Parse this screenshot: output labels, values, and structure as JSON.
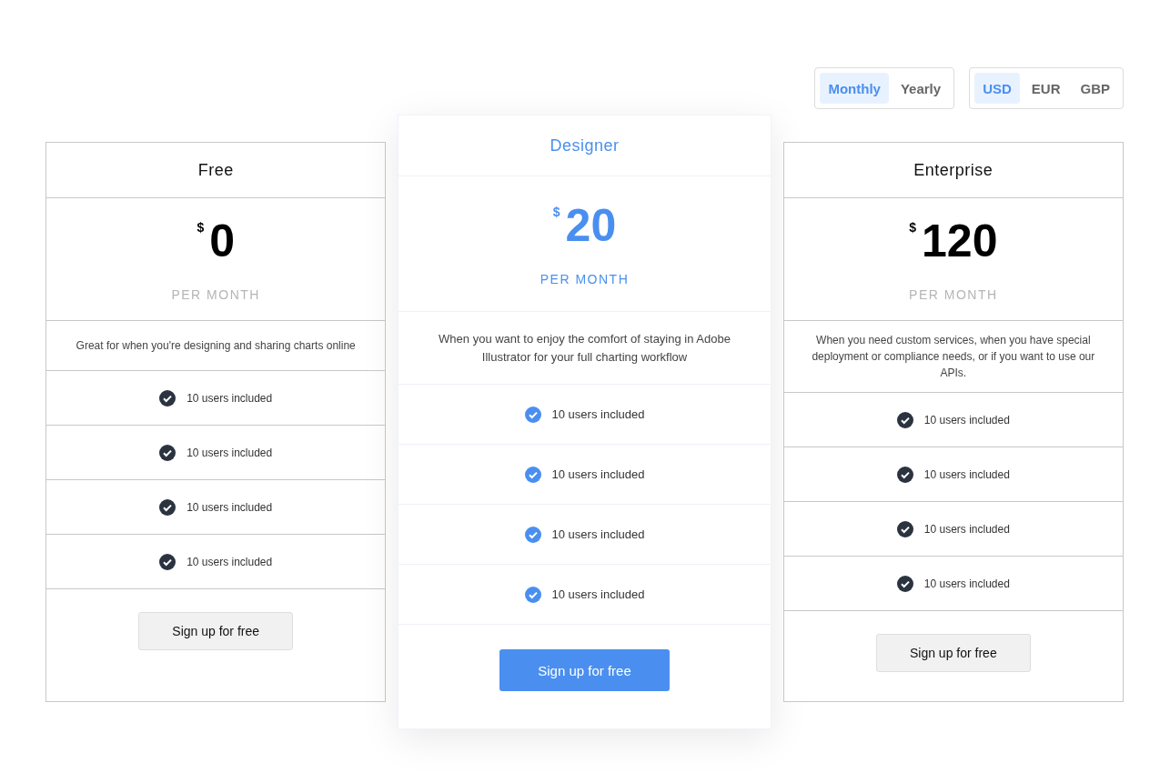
{
  "billing_period": [
    {
      "label": "Monthly",
      "selected": true
    },
    {
      "label": "Yearly",
      "selected": false
    }
  ],
  "currency": [
    {
      "label": "USD",
      "selected": true
    },
    {
      "label": "EUR",
      "selected": false
    },
    {
      "label": "GBP",
      "selected": false
    }
  ],
  "plans": [
    {
      "name": "Free",
      "featured": false,
      "currency_symbol": "$",
      "price": "0",
      "period": "PER MONTH",
      "description": "Great for when you're designing and sharing charts online",
      "features": [
        "10 users included",
        "10 users included",
        "10 users included",
        "10 users included"
      ],
      "button": "Sign up for free"
    },
    {
      "name": "Designer",
      "featured": true,
      "currency_symbol": "$",
      "price": "20",
      "period": "PER MONTH",
      "description": "When you want to enjoy the comfort of staying in Adobe Illustrator for your full charting workflow",
      "features": [
        "10 users included",
        "10 users included",
        "10 users included",
        "10 users included"
      ],
      "button": "Sign up for free"
    },
    {
      "name": "Enterprise",
      "featured": false,
      "currency_symbol": "$",
      "price": "120",
      "period": "PER MONTH",
      "description": "When you need custom services, when you have special deployment or compliance needs, or if you want to use our APIs.",
      "features": [
        "10 users included",
        "10 users included",
        "10 users included",
        "10 users included"
      ],
      "button": "Sign up for free"
    }
  ]
}
